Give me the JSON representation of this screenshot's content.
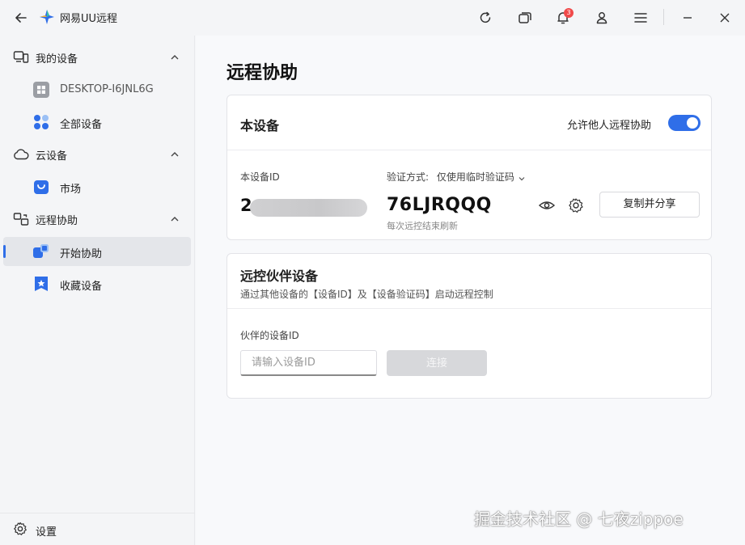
{
  "app": {
    "title": "网易UU远程"
  },
  "titlebar": {
    "icons": [
      "back-arrow-icon",
      "refresh-icon",
      "window-switch-icon",
      "bell-icon",
      "user-icon",
      "menu-icon",
      "minimize-icon",
      "close-icon"
    ],
    "notification_count": "3"
  },
  "sidebar": {
    "groups": [
      {
        "label": "我的设备",
        "icon": "monitor-icon"
      },
      {
        "label": "云设备",
        "icon": "cloud-icon"
      },
      {
        "label": "远程协助",
        "icon": "remote-icon"
      }
    ],
    "items": [
      {
        "label": "DESKTOP-I6JNL6G",
        "icon": "windows-icon"
      },
      {
        "label": "全部设备",
        "icon": "grid-dots-icon"
      },
      {
        "label": "市场",
        "icon": "market-bag-icon"
      },
      {
        "label": "开始协助",
        "icon": "start-assist-icon",
        "active": true
      },
      {
        "label": "收藏设备",
        "icon": "star-bookmark-icon"
      }
    ],
    "settings_label": "设置"
  },
  "main": {
    "page_title": "远程协助",
    "this_device": {
      "heading": "本设备",
      "allow_label": "允许他人远程协助",
      "allow_enabled": true,
      "id_label": "本设备ID",
      "id_visible_prefix": "2",
      "verify_label": "验证方式:",
      "verify_mode": "仅使用临时验证码",
      "code": "76LJRQQQ",
      "code_note": "每次远控结束刷新",
      "copy_button": "复制并分享"
    },
    "partner": {
      "heading": "远控伙伴设备",
      "subtitle": "通过其他设备的【设备ID】及【设备验证码】启动远程控制",
      "id_label": "伙伴的设备ID",
      "input_placeholder": "请输入设备ID",
      "input_value": "",
      "connect_button": "连接"
    }
  },
  "watermark": "掘金技术社区 @ 七夜zippoe",
  "colors": {
    "accent": "#2f6ee8",
    "background": "#f4f5f7",
    "card": "#ffffff",
    "badge": "#f04a4a"
  }
}
